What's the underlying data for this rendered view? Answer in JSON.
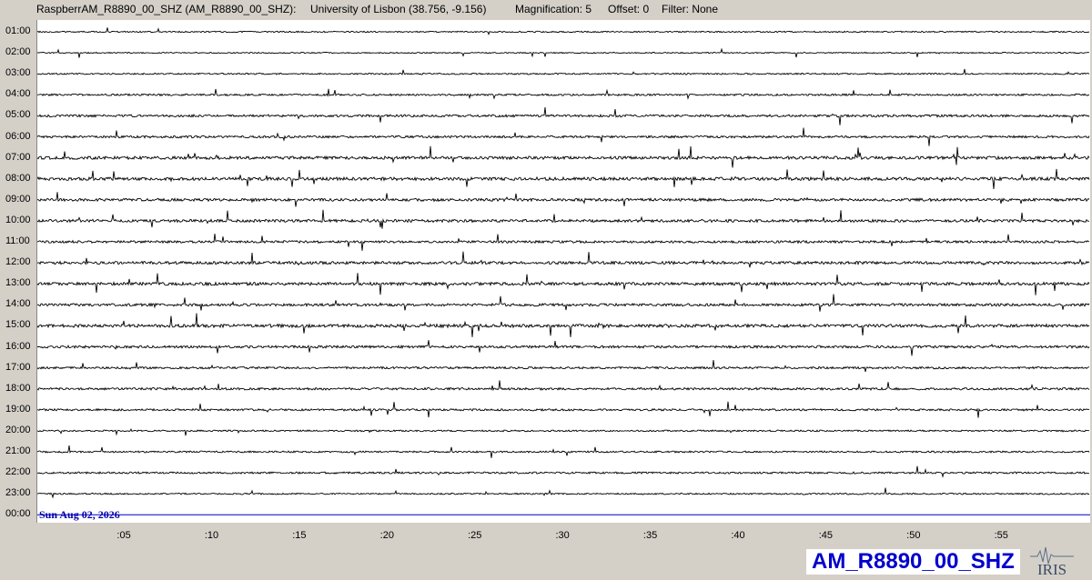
{
  "header": {
    "channel": "RaspberrAM_R8890_00_SHZ (AM_R8890_00_SHZ):",
    "location": "University of Lisbon (38.756, -9.156)",
    "magnification": "Magnification: 5",
    "offset": "Offset: 0",
    "filter": "Filter: None"
  },
  "chart_data": {
    "type": "line",
    "title": "",
    "hour_rows": [
      "01:00",
      "02:00",
      "03:00",
      "04:00",
      "05:00",
      "06:00",
      "07:00",
      "08:00",
      "09:00",
      "10:00",
      "11:00",
      "12:00",
      "13:00",
      "14:00",
      "15:00",
      "16:00",
      "17:00",
      "18:00",
      "19:00",
      "20:00",
      "21:00",
      "22:00",
      "23:00",
      "00:00"
    ],
    "x_ticks": [
      ":05",
      ":10",
      ":15",
      ":20",
      ":25",
      ":30",
      ":35",
      ":40",
      ":45",
      ":50",
      ":55"
    ],
    "x_tick_minutes": [
      5,
      10,
      15,
      20,
      25,
      30,
      35,
      40,
      45,
      50,
      55
    ],
    "xlim_minutes": [
      0,
      60
    ],
    "date_label": "Sun Aug 02, 2026",
    "row_activity": [
      0.3,
      0.25,
      0.35,
      0.5,
      0.7,
      0.65,
      0.95,
      1.0,
      0.85,
      0.85,
      0.7,
      0.9,
      0.95,
      0.8,
      1.0,
      0.75,
      0.6,
      0.65,
      0.55,
      0.4,
      0.45,
      0.5,
      0.35,
      0.0
    ],
    "trace_colors": [
      "#000000"
    ],
    "final_row_color": "#0000cc"
  },
  "footer": {
    "station": "AM_R8890_00_SHZ",
    "logo_text": "IRIS"
  }
}
